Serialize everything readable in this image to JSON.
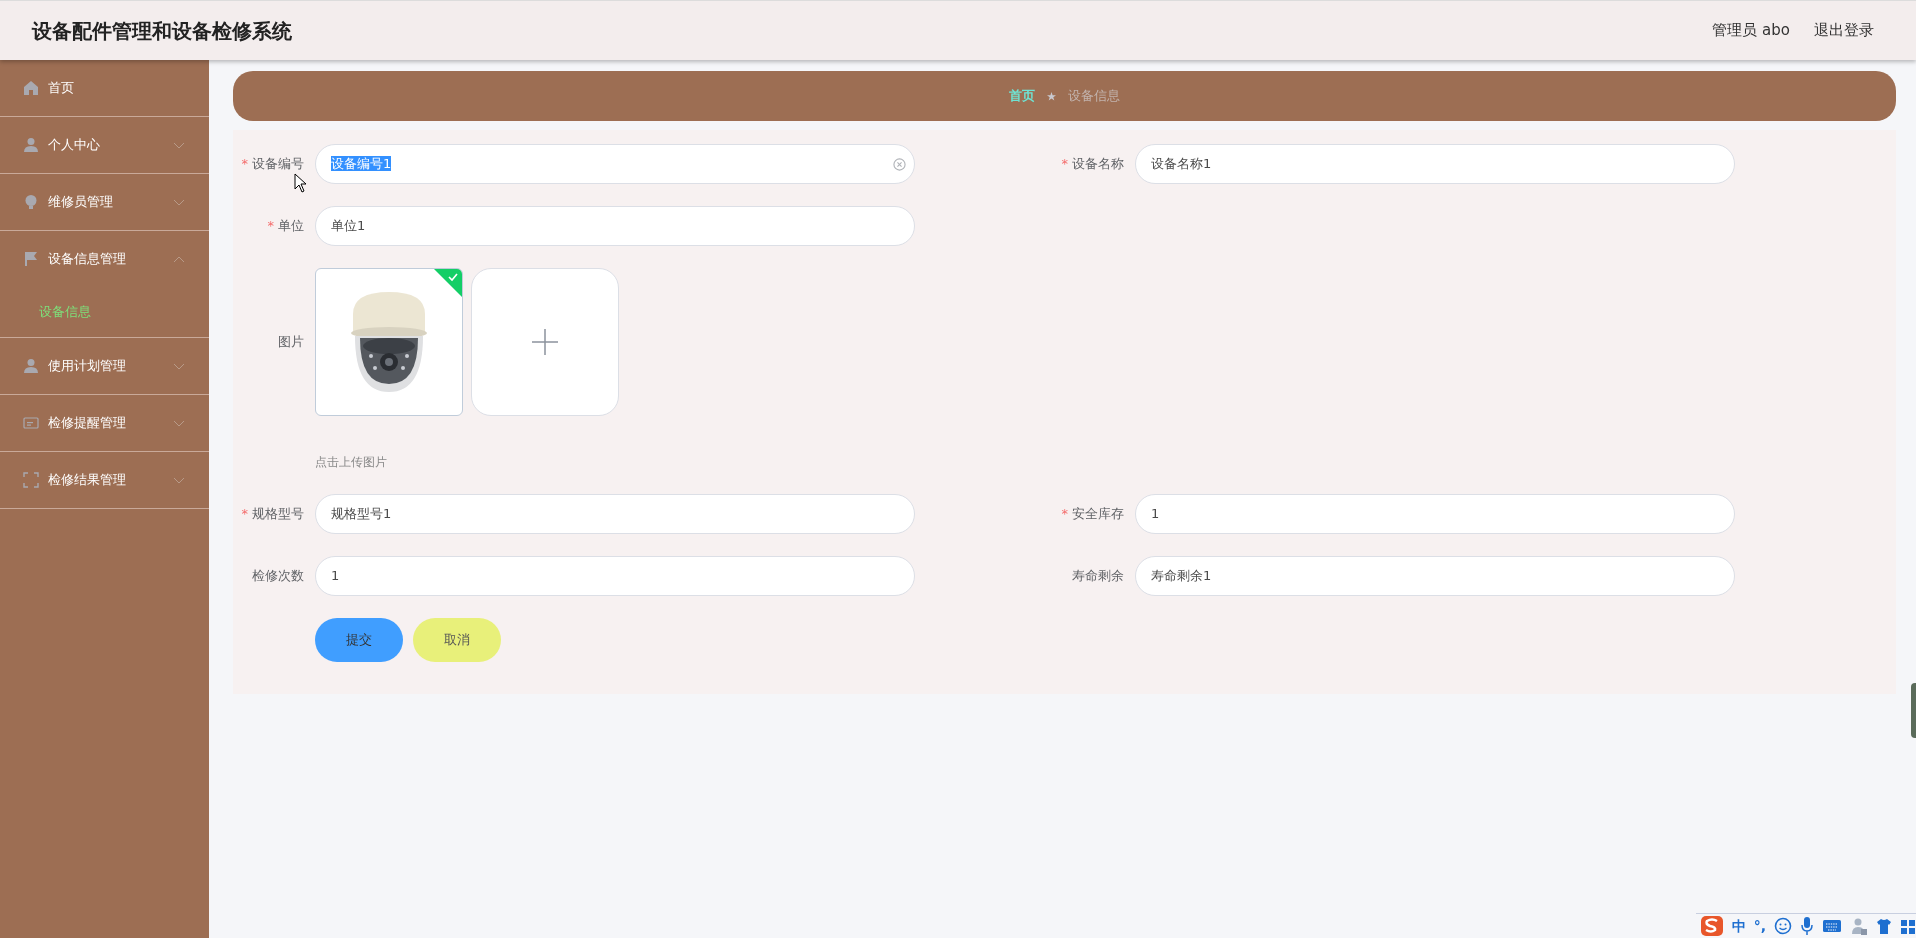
{
  "header": {
    "title": "设备配件管理和设备检修系统",
    "user": "管理员 abo",
    "logout": "退出登录"
  },
  "sidebar": {
    "items": [
      {
        "label": "首页",
        "kind": "link"
      },
      {
        "label": "个人中心",
        "kind": "menu",
        "expanded": false
      },
      {
        "label": "维修员管理",
        "kind": "menu",
        "expanded": false
      },
      {
        "label": "设备信息管理",
        "kind": "menu",
        "expanded": true,
        "children": [
          {
            "label": "设备信息",
            "selected": true
          }
        ]
      },
      {
        "label": "使用计划管理",
        "kind": "menu",
        "expanded": false
      },
      {
        "label": "检修提醒管理",
        "kind": "menu",
        "expanded": false
      },
      {
        "label": "检修结果管理",
        "kind": "menu",
        "expanded": false
      }
    ]
  },
  "breadcrumb": [
    {
      "label": "首页",
      "selected": false
    },
    {
      "label": "设备信息",
      "selected": true
    }
  ],
  "form": {
    "rows": [
      [
        {
          "kind": "text",
          "required_mark": "*",
          "label": "设备编号",
          "value": "设备编号1",
          "text_selected": true,
          "clearable": true
        },
        {
          "kind": "text",
          "required_mark": "*",
          "label": "设备名称",
          "value": "设备名称1",
          "text_selected": false,
          "clearable": false
        }
      ],
      [
        {
          "kind": "text",
          "required_mark": "*",
          "label": "单位",
          "value": "单位1",
          "text_selected": false,
          "clearable": false
        }
      ],
      [
        {
          "kind": "upload",
          "label": "图片",
          "images": [
            {
              "kind": "picture",
              "uploaded": true
            }
          ],
          "hint": "点击上传图片"
        }
      ],
      [
        {
          "kind": "text",
          "required_mark": "*",
          "label": "规格型号",
          "value": "规格型号1",
          "text_selected": false,
          "clearable": false
        },
        {
          "kind": "text",
          "required_mark": "*",
          "label": "安全库存",
          "value": "1",
          "text_selected": false,
          "clearable": false
        }
      ],
      [
        {
          "kind": "text",
          "label": "检修次数",
          "value": "1",
          "text_selected": false,
          "clearable": false
        },
        {
          "kind": "text",
          "label": "寿命剩余",
          "value": "寿命剩余1",
          "text_selected": false,
          "clearable": false
        }
      ]
    ],
    "buttons": [
      {
        "label": "提交",
        "kind": "primary"
      },
      {
        "label": "取消",
        "kind": "cancel"
      }
    ]
  },
  "ime_toolbar": {
    "items": [
      {
        "kind": "logo"
      },
      {
        "kind": "text",
        "label": "中"
      },
      {
        "kind": "text",
        "label": "°,"
      },
      {
        "kind": "smiley"
      },
      {
        "kind": "mic"
      },
      {
        "kind": "keyboard"
      },
      {
        "kind": "user"
      },
      {
        "kind": "shirt"
      },
      {
        "kind": "grid"
      }
    ]
  }
}
